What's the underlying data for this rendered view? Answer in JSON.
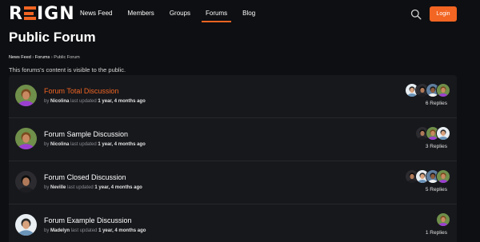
{
  "header": {
    "logo": {
      "r": "R",
      "rest": "IGN"
    },
    "nav": [
      "News Feed",
      "Members",
      "Groups",
      "Forums",
      "Blog"
    ],
    "active_nav": "Forums",
    "login_label": "Login",
    "accent": "#f26522"
  },
  "page": {
    "title": "Public Forum",
    "breadcrumb": [
      "News Feed",
      "Forums",
      "Public Forum"
    ],
    "breadcrumb_sep": "›",
    "description": "This forums's content is visible to the public."
  },
  "forums": [
    {
      "title": "Forum Total Discussion",
      "highlight": true,
      "by": "by",
      "author": "Nicolina",
      "updated": "last updated",
      "time": "1 year, 4 months ago",
      "replies": "6 Replies",
      "avatar": "avatar-green-hair",
      "voices": [
        "avatar-green-hair",
        "avatar-man-dark",
        "avatar-woman-dark",
        "avatar-man-light"
      ]
    },
    {
      "title": "Forum Sample Discussion",
      "highlight": false,
      "by": "by",
      "author": "Nicolina",
      "updated": "last updated",
      "time": "1 year, 4 months ago",
      "replies": "3 Replies",
      "avatar": "avatar-green-hair",
      "voices": [
        "avatar-man-light",
        "avatar-green-hair",
        "avatar-woman-dark"
      ]
    },
    {
      "title": "Forum Closed Discussion",
      "highlight": false,
      "by": "by",
      "author": "Neville",
      "updated": "last updated",
      "time": "1 year, 4 months ago",
      "replies": "5 Replies",
      "avatar": "avatar-woman-dark",
      "voices": [
        "avatar-green-hair",
        "avatar-man-dark",
        "avatar-man-light",
        "avatar-woman-dark"
      ]
    },
    {
      "title": "Forum Example Discussion",
      "highlight": false,
      "by": "by",
      "author": "Madelyn",
      "updated": "last updated",
      "time": "1 year, 4 months ago",
      "replies": "1 Replies",
      "avatar": "avatar-man-light",
      "voices": [
        "avatar-green-hair"
      ]
    }
  ]
}
